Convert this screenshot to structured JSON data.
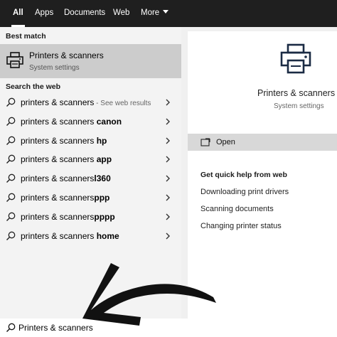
{
  "tabs": [
    {
      "label": "All"
    },
    {
      "label": "Apps"
    },
    {
      "label": "Documents"
    },
    {
      "label": "Web"
    },
    {
      "label": "More"
    }
  ],
  "left": {
    "best_match_heading": "Best match",
    "best_match": {
      "title": "Printers & scanners",
      "subtitle": "System settings",
      "icon": "printer-icon"
    },
    "web_heading": "Search the web",
    "web_results": [
      {
        "query": "printers & scanners",
        "suffix": "",
        "hint": " - See web results"
      },
      {
        "query": "printers & scanners ",
        "suffix": "canon",
        "hint": ""
      },
      {
        "query": "printers & scanners ",
        "suffix": "hp",
        "hint": ""
      },
      {
        "query": "printers & scanners ",
        "suffix": "app",
        "hint": ""
      },
      {
        "query": "printers & scanners",
        "suffix": "l360",
        "hint": ""
      },
      {
        "query": "printers & scanners",
        "suffix": "ppp",
        "hint": ""
      },
      {
        "query": "printers & scanners",
        "suffix": "pppp",
        "hint": ""
      },
      {
        "query": "printers & scanners ",
        "suffix": "home",
        "hint": ""
      }
    ]
  },
  "right": {
    "title": "Printers & scanners",
    "subtitle": "System settings",
    "open_label": "Open",
    "quick_help_heading": "Get quick help from web",
    "quick_links": [
      "Downloading print drivers",
      "Scanning documents",
      "Changing printer status"
    ]
  },
  "search": {
    "value": "Printers & scanners"
  },
  "colors": {
    "topbar": "#1f1f1f",
    "best_match_bg": "#cccccc",
    "open_row_bg": "#d8d8d8",
    "annotation_arrow": "#111111"
  }
}
